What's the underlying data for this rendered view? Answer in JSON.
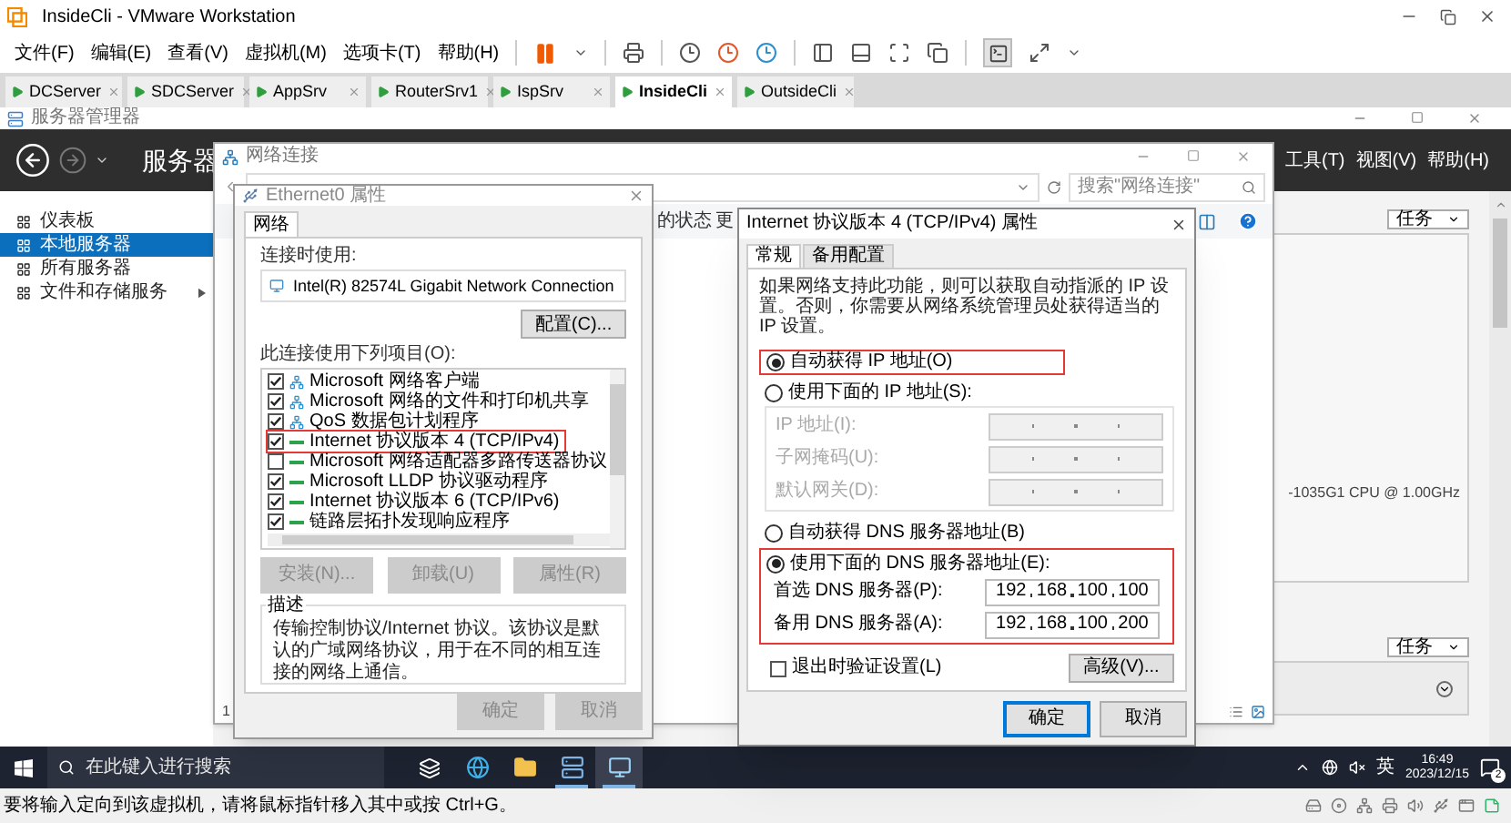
{
  "window": {
    "title": "InsideCli - VMware Workstation"
  },
  "menu": [
    "文件(F)",
    "编辑(E)",
    "查看(V)",
    "虚拟机(M)",
    "选项卡(T)",
    "帮助(H)"
  ],
  "vm_tabs": [
    {
      "label": "DCServer",
      "selected": false
    },
    {
      "label": "SDCServer",
      "selected": false
    },
    {
      "label": "AppSrv",
      "selected": false
    },
    {
      "label": "RouterSrv1",
      "selected": false
    },
    {
      "label": "IspSrv",
      "selected": false
    },
    {
      "label": "InsideCli",
      "selected": true
    },
    {
      "label": "OutsideCli",
      "selected": false
    }
  ],
  "server_manager": {
    "title": "服务器管理器",
    "header_title": "服务器",
    "header_menu": [
      "工具(T)",
      "视图(V)",
      "帮助(H)"
    ],
    "sidebar": [
      {
        "label": "仪表板",
        "selected": false,
        "expandable": false
      },
      {
        "label": "本地服务器",
        "selected": true,
        "expandable": false
      },
      {
        "label": "所有服务器",
        "selected": false,
        "expandable": false
      },
      {
        "label": "文件和存储服务",
        "selected": false,
        "expandable": true
      }
    ],
    "tasks_buttons": [
      "任务",
      "任务"
    ],
    "cpu_text": "-1035G1 CPU @ 1.00GHz"
  },
  "network_connections": {
    "title": "网络连接",
    "search": {
      "placeholder": "搜索\"网络连接\""
    },
    "toolbar_texts": [
      "的状态",
      "更"
    ],
    "status_text": "1"
  },
  "ethernet_dialog": {
    "title": "Ethernet0 属性",
    "tab": "网络",
    "connect_using_label": "连接时使用:",
    "adapter": "Intel(R) 82574L Gigabit Network Connection",
    "configure_button": "配置(C)...",
    "items_label": "此连接使用下列项目(O):",
    "items": [
      {
        "label": "Microsoft 网络客户端",
        "checked": true,
        "kind": "service",
        "highlighted": false
      },
      {
        "label": "Microsoft 网络的文件和打印机共享",
        "checked": true,
        "kind": "service",
        "highlighted": false
      },
      {
        "label": "QoS 数据包计划程序",
        "checked": true,
        "kind": "service",
        "highlighted": false
      },
      {
        "label": "Internet 协议版本 4 (TCP/IPv4)",
        "checked": true,
        "kind": "protocol",
        "highlighted": true
      },
      {
        "label": "Microsoft 网络适配器多路传送器协议",
        "checked": false,
        "kind": "protocol",
        "highlighted": false
      },
      {
        "label": "Microsoft LLDP 协议驱动程序",
        "checked": true,
        "kind": "protocol",
        "highlighted": false
      },
      {
        "label": "Internet 协议版本 6 (TCP/IPv6)",
        "checked": true,
        "kind": "protocol",
        "highlighted": false
      },
      {
        "label": "链路层拓扑发现响应程序",
        "checked": true,
        "kind": "protocol",
        "highlighted": false
      }
    ],
    "item_buttons": [
      {
        "label": "安装(N)...",
        "disabled": true
      },
      {
        "label": "卸载(U)",
        "disabled": true
      },
      {
        "label": "属性(R)",
        "disabled": true
      }
    ],
    "description_label": "描述",
    "description": "传输控制协议/Internet 协议。该协议是默认的广域网络协议，用于在不同的相互连接的网络上通信。",
    "buttons": [
      {
        "label": "确定",
        "disabled": true
      },
      {
        "label": "取消",
        "disabled": true
      }
    ]
  },
  "ipv4_dialog": {
    "title": "Internet 协议版本 4 (TCP/IPv4) 属性",
    "tabs": [
      {
        "label": "常规",
        "selected": true
      },
      {
        "label": "备用配置",
        "selected": false
      }
    ],
    "intro": "如果网络支持此功能，则可以获取自动指派的 IP 设置。否则，你需要从网络系统管理员处获得适当的 IP 设置。",
    "ip_mode": [
      {
        "label": "自动获得 IP 地址(O)",
        "selected": true,
        "highlighted": true
      },
      {
        "label": "使用下面的 IP 地址(S):",
        "selected": false,
        "highlighted": false
      }
    ],
    "ip_fields": [
      {
        "label": "IP 地址(I):",
        "disabled": true
      },
      {
        "label": "子网掩码(U):",
        "disabled": true
      },
      {
        "label": "默认网关(D):",
        "disabled": true
      }
    ],
    "dns_mode": [
      {
        "label": "自动获得 DNS 服务器地址(B)",
        "selected": false,
        "highlighted": false
      },
      {
        "label": "使用下面的 DNS 服务器地址(E):",
        "selected": true,
        "highlighted": true
      }
    ],
    "dns_fields": [
      {
        "label": "首选 DNS 服务器(P):",
        "octets": [
          "192",
          "168",
          "100",
          "100"
        ]
      },
      {
        "label": "备用 DNS 服务器(A):",
        "octets": [
          "192",
          "168",
          "100",
          "200"
        ]
      }
    ],
    "validate": {
      "label": "退出时验证设置(L)",
      "checked": false
    },
    "advanced_button": "高级(V)...",
    "buttons": [
      {
        "label": "确定",
        "default": true
      },
      {
        "label": "取消",
        "default": false
      }
    ]
  },
  "taskbar": {
    "search": {
      "placeholder": "在此键入进行搜索"
    },
    "apps": [
      {
        "kind": "task_view",
        "selected": false,
        "running": false
      },
      {
        "kind": "browser",
        "selected": false,
        "running": false
      },
      {
        "kind": "folder",
        "selected": false,
        "running": false
      },
      {
        "kind": "server_manager",
        "selected": false,
        "running": true
      },
      {
        "kind": "network",
        "selected": true,
        "running": true
      }
    ],
    "ime": "英",
    "time": "16:49",
    "date": "2023/12/15",
    "notification_count": "2"
  },
  "status_bar": {
    "text": "要将输入定向到该虚拟机，请将鼠标指针移入其中或按 Ctrl+G。"
  }
}
